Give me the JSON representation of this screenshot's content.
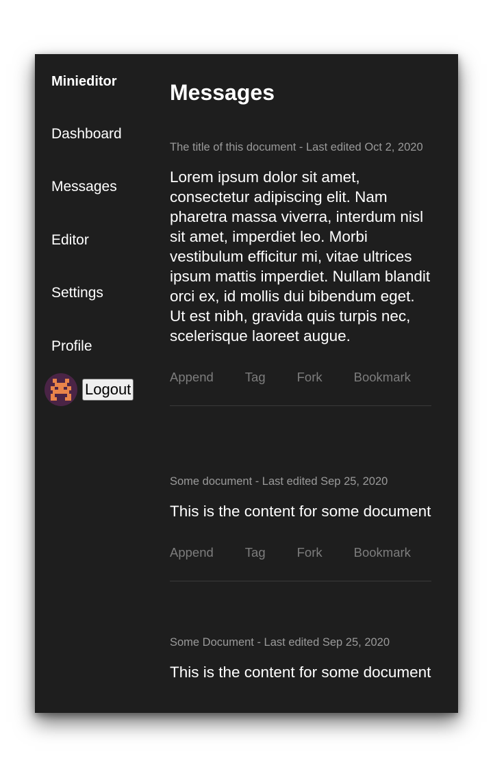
{
  "sidebar": {
    "brand": "Minieditor",
    "nav": [
      "Dashboard",
      "Messages",
      "Editor",
      "Settings",
      "Profile"
    ],
    "logout_label": "Logout"
  },
  "main": {
    "title": "Messages",
    "actions": [
      "Append",
      "Tag",
      "Fork",
      "Bookmark"
    ],
    "documents": [
      {
        "meta": "The title of this document - Last edited Oct 2, 2020",
        "content": "Lorem ipsum dolor sit amet, consectetur adipiscing elit. Nam pharetra massa viverra, interdum nisl sit amet, imperdiet leo. Morbi vestibulum efficitur mi, vitae ultrices ipsum mattis imperdiet. Nullam blandit orci ex, id mollis dui bibendum eget. Ut est nibh, gravida quis turpis nec, scelerisque laoreet augue."
      },
      {
        "meta": "Some document - Last edited Sep 25, 2020",
        "content": "This is the content for some document"
      },
      {
        "meta": "Some Document - Last edited Sep 25, 2020",
        "content": "This is the content for some document"
      }
    ]
  },
  "colors": {
    "background": "#1e1e1e",
    "meta_text": "#9a9a9a",
    "action_text": "#7d7d7d",
    "avatar_bg": "#4a2446",
    "avatar_fg": "#e8844a"
  }
}
